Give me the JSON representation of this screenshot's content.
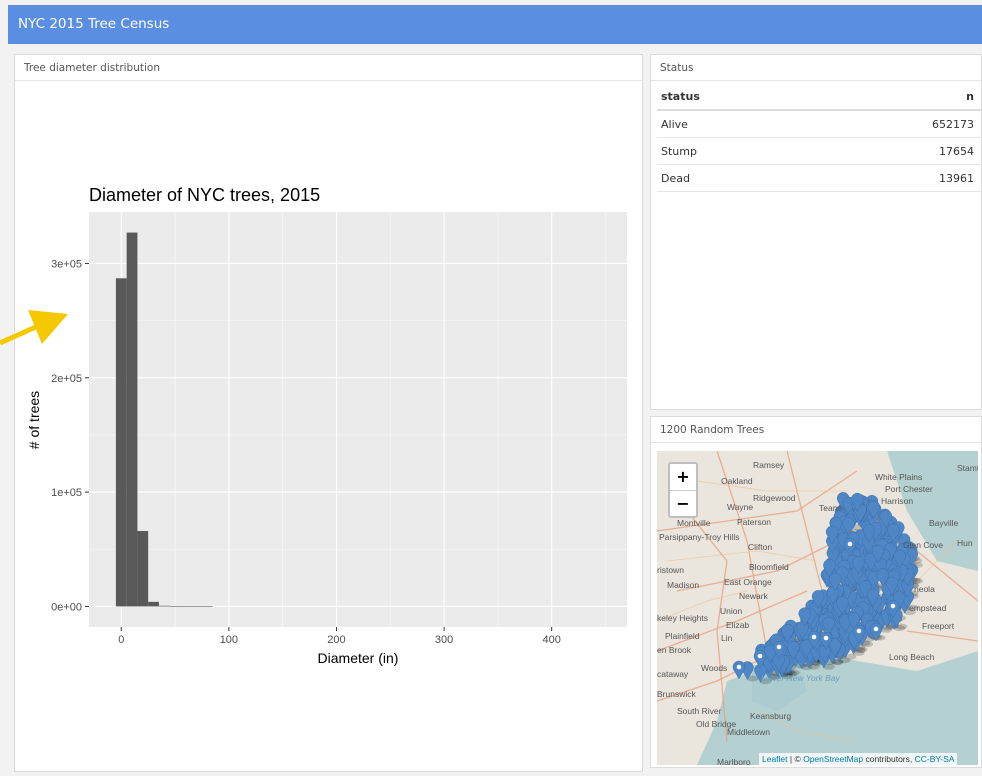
{
  "app_title": "NYC 2015 Tree Census",
  "histogram_panel": {
    "header": "Tree diameter distribution"
  },
  "chart_data": {
    "type": "bar",
    "title": "Diameter of NYC trees, 2015",
    "xlabel": "Diameter (in)",
    "ylabel": "# of trees",
    "bin_width": 10,
    "x": [
      0,
      10,
      20,
      30,
      40,
      50,
      60,
      70,
      80
    ],
    "values": [
      287000,
      327000,
      66000,
      4000,
      600,
      200,
      100,
      50,
      20
    ],
    "xlim": [
      -30,
      470
    ],
    "ylim": [
      -18000,
      345000
    ],
    "x_ticks": [
      0,
      100,
      200,
      300,
      400
    ],
    "x_tick_labels": [
      "0",
      "100",
      "200",
      "300",
      "400"
    ],
    "y_ticks": [
      0,
      100000,
      200000,
      300000
    ],
    "y_tick_labels": [
      "0e+00",
      "1e+05",
      "2e+05",
      "3e+05"
    ],
    "grid": true,
    "bar_color": "#595959",
    "panel_background": "#ebebeb"
  },
  "status_panel": {
    "header": "Status",
    "columns": [
      "status",
      "n"
    ],
    "rows": [
      {
        "status": "Alive",
        "n": "652173"
      },
      {
        "status": "Stump",
        "n": "17654"
      },
      {
        "status": "Dead",
        "n": "13961"
      }
    ]
  },
  "map_panel": {
    "header": "1200 Random Trees",
    "zoom_in": "+",
    "zoom_out": "−",
    "marker_color": "#4f86c6",
    "place_labels": [
      "Ramsey",
      "Stamford",
      "Oakland",
      "White Plains",
      "Port Chester",
      "Ridgewood",
      "Harrison",
      "Wayne",
      "Paterson",
      "Montville",
      "Teane",
      "Bayville",
      "Parsippany-Troy Hills",
      "Clifton",
      "Glen Cove",
      "Hun",
      "ristown",
      "Bloomfield",
      "Madison",
      "East Orange",
      "Newark",
      "neola",
      "Union",
      "empstead",
      "keley Heights",
      "Elizab",
      "Freeport",
      "Plainfield",
      "en Brook",
      "Lin",
      "Long Beach",
      "Woods",
      "cataway",
      "Lower New York Bay",
      "Brunswick",
      "South River",
      "Keansburg",
      "Old Bridge",
      "Middletown",
      "Marlboro"
    ],
    "attribution": {
      "leaflet": "Leaflet",
      "sep": " | © ",
      "osm": "OpenStreetMap",
      "contrib": " contributors, ",
      "license": "CC-BY-SA"
    }
  }
}
